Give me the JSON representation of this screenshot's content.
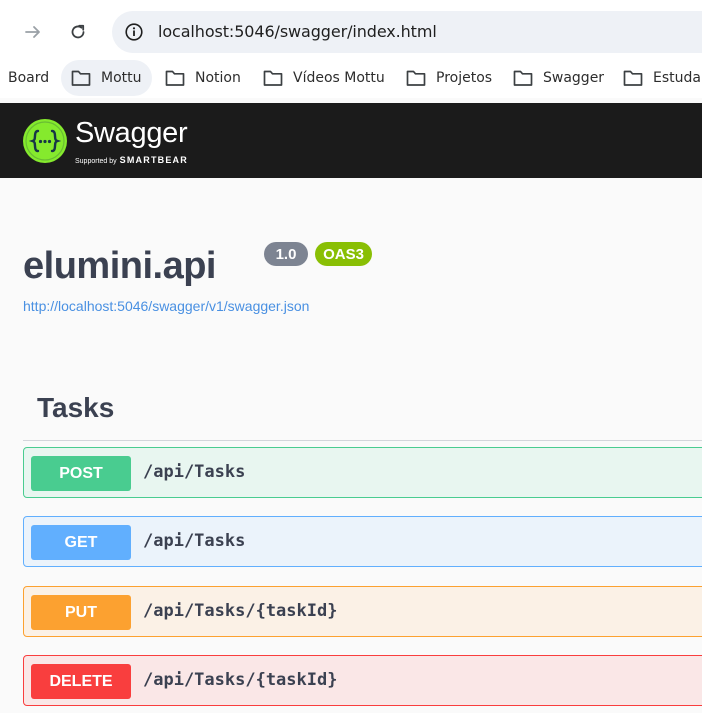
{
  "browser": {
    "url": "localhost:5046/swagger/index.html"
  },
  "bookmarks": [
    {
      "label": "Board"
    },
    {
      "label": "Mottu"
    },
    {
      "label": "Notion"
    },
    {
      "label": "Vídeos Mottu"
    },
    {
      "label": "Projetos"
    },
    {
      "label": "Swagger"
    },
    {
      "label": "Estudar"
    }
  ],
  "swagger_header": {
    "name": "Swagger",
    "supported_by": "Supported by",
    "smartbear": "SMARTBEAR",
    "logo_color": "#85ea2d"
  },
  "info": {
    "title": "elumini.api",
    "version": "1.0",
    "oas": "OAS3",
    "spec_url": "http://localhost:5046/swagger/v1/swagger.json"
  },
  "tags": [
    {
      "name": "Tasks",
      "operations": [
        {
          "method": "POST",
          "path": "/api/Tasks",
          "color": "#49cc90",
          "bg": "#e8f6f0"
        },
        {
          "method": "GET",
          "path": "/api/Tasks",
          "color": "#61affe",
          "bg": "#ebf3fb"
        },
        {
          "method": "PUT",
          "path": "/api/Tasks/{taskId}",
          "color": "#fca130",
          "bg": "#fbf1e6"
        },
        {
          "method": "DELETE",
          "path": "/api/Tasks/{taskId}",
          "color": "#f93e3e",
          "bg": "#fae7e7"
        }
      ]
    }
  ]
}
